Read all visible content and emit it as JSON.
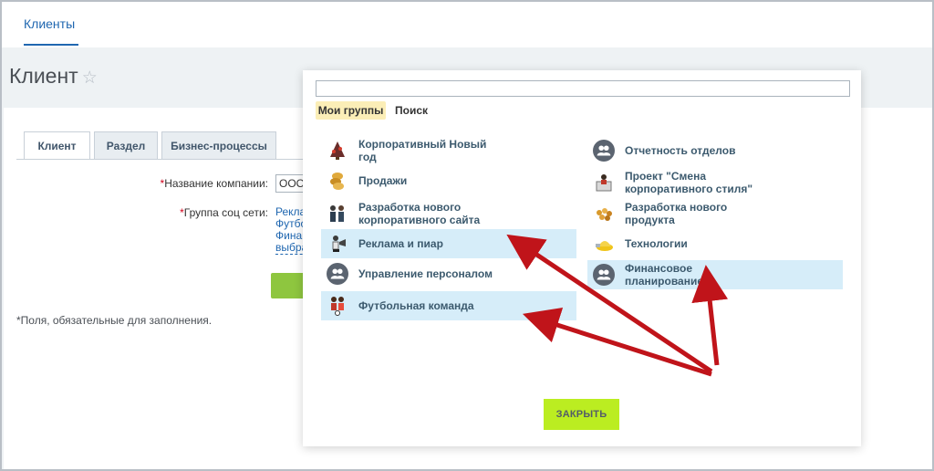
{
  "nav": {
    "tab_label": "Клиенты"
  },
  "page": {
    "title": "Клиент",
    "star": "☆"
  },
  "form": {
    "tabs": [
      {
        "label": "Клиент"
      },
      {
        "label": "Раздел"
      },
      {
        "label": "Бизнес-процессы"
      }
    ],
    "company_label": "Название компании:",
    "company_value": "ООО",
    "group_label": "Группа соц сети:",
    "required_mark": "*",
    "group_lines": [
      "Рекла",
      "Футбо",
      "Финан",
      "выбра"
    ],
    "required_note": "Поля, обязательные для заполнения."
  },
  "popup": {
    "search_value": "",
    "tabs": [
      {
        "label": "Мои группы"
      },
      {
        "label": "Поиск"
      }
    ],
    "groups_left": [
      {
        "name": "Корпоративный Новый год",
        "icon": "christmas-icon",
        "highlighted": false
      },
      {
        "name": "Продажи",
        "icon": "coins-icon",
        "highlighted": false
      },
      {
        "name": "Разработка нового корпоративного сайта",
        "icon": "team-icon",
        "highlighted": false
      },
      {
        "name": "Реклама и пиар",
        "icon": "megaphone-icon",
        "highlighted": true
      },
      {
        "name": "Управление персоналом",
        "icon": "group-avatar-icon",
        "highlighted": false
      },
      {
        "name": "Футбольная команда",
        "icon": "football-icon",
        "highlighted": true
      }
    ],
    "groups_right": [
      {
        "name": "Отчетность отделов",
        "icon": "group-avatar-icon",
        "highlighted": false
      },
      {
        "name": "Проект \"Смена корпоративного стиля\"",
        "icon": "style-icon",
        "highlighted": false
      },
      {
        "name": "Разработка нового продукта",
        "icon": "product-icon",
        "highlighted": false
      },
      {
        "name": "Технологии",
        "icon": "tech-icon",
        "highlighted": false
      },
      {
        "name": "Финансовое планирование",
        "icon": "group-avatar-icon",
        "highlighted": true
      }
    ],
    "close_label": "ЗАКРЫТЬ"
  },
  "colors": {
    "accent": "#2067b0",
    "highlight": "#d6edf9",
    "close_button": "#bbed21",
    "arrow": "#c0141a"
  }
}
